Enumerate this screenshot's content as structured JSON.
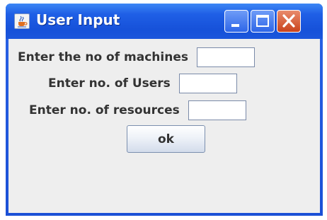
{
  "window": {
    "title": "User Input",
    "icon": "java-cup-icon",
    "controls": [
      "minimize-icon",
      "maximize-icon",
      "close-icon"
    ],
    "accent_color": "#1f5fe6",
    "close_color": "#d2532b"
  },
  "form": {
    "machines_label": "Enter the no of machines",
    "machines_value": "",
    "users_label": "Enter no. of Users",
    "users_value": "",
    "resources_label": "Enter no. of resources",
    "resources_value": "",
    "ok_label": "ok"
  }
}
